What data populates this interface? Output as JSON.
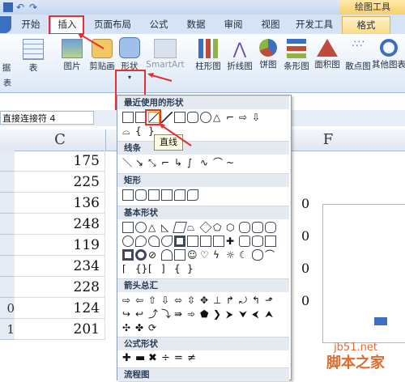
{
  "ribbon_tabs": [
    "开始",
    "插入",
    "页面布局",
    "公式",
    "数据",
    "审阅",
    "视图",
    "开发工具",
    "格式"
  ],
  "context_tools": "绘图工具",
  "ribbon_buttons": {
    "partial_left": "据",
    "partial_left2": "表",
    "partial_left3": "表",
    "picture": "图片",
    "clipart": "剪贴画",
    "shapes": "形状",
    "smartart": "SmartArt",
    "column": "柱形图",
    "line": "折线图",
    "pie": "饼图",
    "bar": "条形图",
    "area": "面积图",
    "scatter": "散点图",
    "other": "其他图表"
  },
  "name_box": "直接连接符 4",
  "column_headers": [
    "C",
    "F"
  ],
  "row_numbers": [
    "",
    "",
    "",
    "",
    "",
    "",
    "",
    "0",
    "1"
  ],
  "cells": [
    "175",
    "225",
    "136",
    "248",
    "119",
    "234",
    "228",
    "124",
    "201"
  ],
  "dropdown": {
    "recent": "最近使用的形状",
    "lines": "线条",
    "rect": "矩形",
    "basic": "基本形状",
    "arrows": "箭头总汇",
    "formula": "公式形状",
    "flow": "流程图"
  },
  "tooltip": "直线",
  "chart_ticks": [
    "0",
    "0",
    "0",
    "0"
  ],
  "watermark": {
    "line1": "jb51.net",
    "line2": "脚本之家"
  },
  "colors": {
    "highlight": "#e53030",
    "ribbon": "#dce8f7",
    "accent": "#f7cf6b"
  }
}
